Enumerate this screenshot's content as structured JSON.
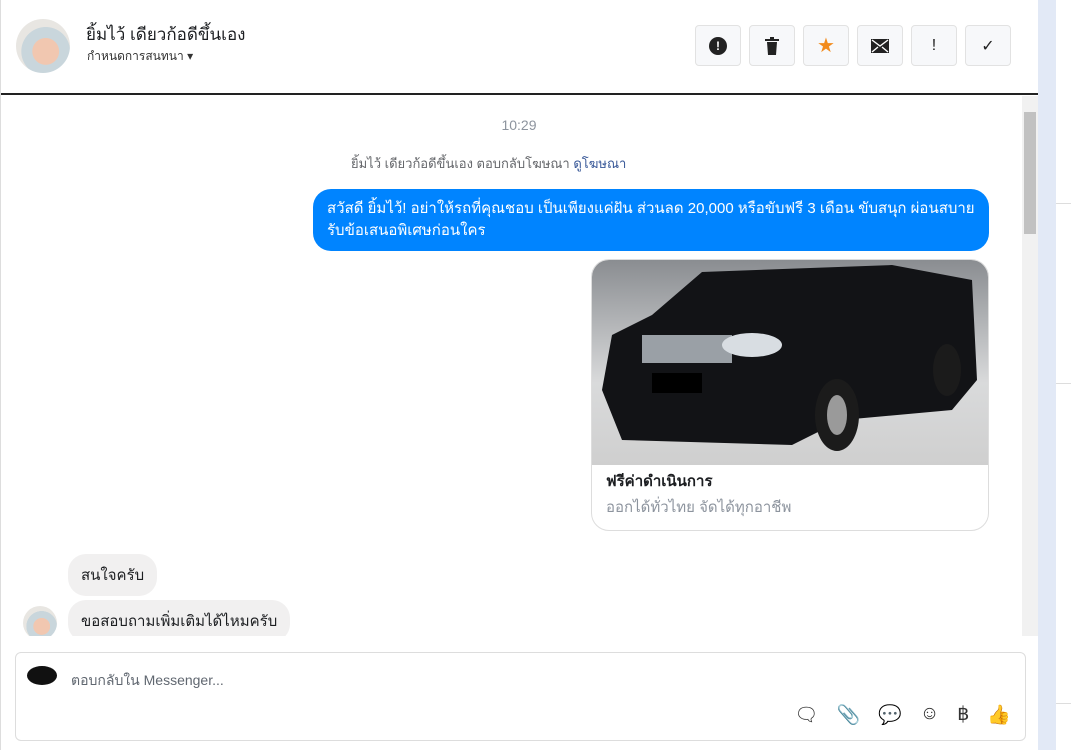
{
  "header": {
    "name": "ยิ้มไว้ เดียวก้อดีขึ้นเอง",
    "subtitle": "กำหนดการสนทนา",
    "tools": [
      {
        "icon": "alert-circle-icon",
        "glyph": "⬤"
      },
      {
        "icon": "trash-icon",
        "glyph": "🗑"
      },
      {
        "icon": "star-icon",
        "glyph": "★"
      },
      {
        "icon": "mail-icon",
        "glyph": "✉"
      },
      {
        "icon": "exclamation-icon",
        "glyph": "!"
      },
      {
        "icon": "check-icon",
        "glyph": "✓"
      }
    ]
  },
  "chat": {
    "time": "10:29",
    "reply_note": "ยิ้มไว้ เดียวก้อดีขึ้นเอง ตอบกลับโฆษณา",
    "reply_link": "ดูโฆษณา",
    "outgoing": "สวัสดี ยิ้มไว้! อย่าให้รถที่คุณชอบ เป็นเพียงแค่ฝัน ส่วนลด 20,000 หรือขับฟรี 3 เดือน ขับสนุก ผ่อนสบาย รับข้อเสนอพิเศษก่อนใคร",
    "card": {
      "title": "ฟรีค่าดำเนินการ",
      "desc": "ออกได้ทั่วไทย จัดได้ทุกอาชีพ"
    },
    "incoming": [
      "สนใจครับ",
      "ขอสอบถามเพิ่มเติมได้ไหมครับ"
    ]
  },
  "composer": {
    "placeholder": "ตอบกลับใน Messenger...",
    "icons": [
      "saved-reply-icon",
      "attachment-icon",
      "chat-icon",
      "emoji-icon",
      "baht-icon",
      "thumbs-up-icon"
    ]
  },
  "colors": {
    "accent": "#0084ff",
    "star": "#f28b1d"
  }
}
